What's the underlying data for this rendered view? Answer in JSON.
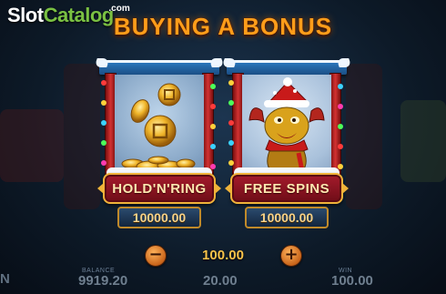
{
  "watermark": {
    "slot": "Slot",
    "catalog": "Catalog",
    "com": ".com"
  },
  "title": "BUYING A BONUS",
  "options": [
    {
      "label": "HOLD'N'RING",
      "price": "10000.00"
    },
    {
      "label": "FREE SPINS",
      "price": "10000.00"
    }
  ],
  "bet": {
    "minus": "−",
    "value": "100.00",
    "plus": "+"
  },
  "footer": {
    "balance_label": "BALANCE",
    "balance_value": "9919.20",
    "bet_value": "20.00",
    "win_label": "WIN",
    "win_value": "100.00",
    "left_edge": "N"
  },
  "colors": {
    "title": "#ff9d1a",
    "button": "#a51b2c",
    "accent_gold": "#f0b33a",
    "price_text": "#f7d38a"
  }
}
